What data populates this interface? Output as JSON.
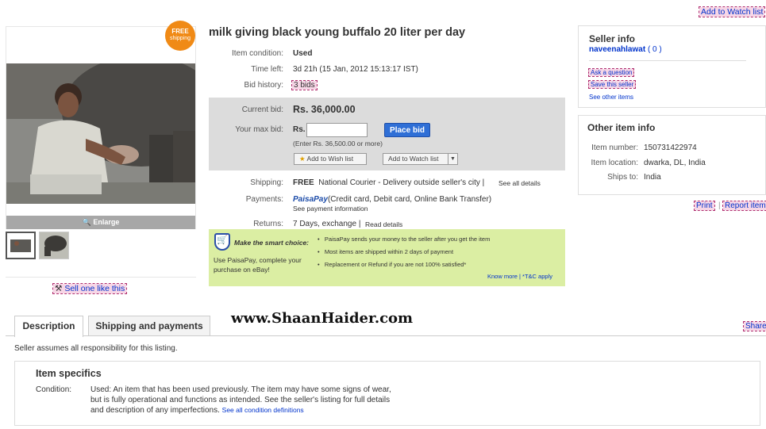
{
  "top_watch": "Add to Watch list",
  "badge": {
    "line1": "FREE",
    "line2": "shipping"
  },
  "enlarge": "Enlarge",
  "sell_one": "Sell one like this",
  "title": "milk giving black young buffalo 20 liter per day",
  "condition": {
    "label": "Item condition:",
    "value": "Used"
  },
  "time_left": {
    "label": "Time left:",
    "value": "3d 21h (15 Jan, 2012 15:13:17 IST)"
  },
  "bid_history": {
    "label": "Bid history:",
    "value": "3 bids"
  },
  "current_bid": {
    "label": "Current bid:",
    "value": "Rs. 36,000.00"
  },
  "max_bid": {
    "label": "Your max bid:",
    "currency": "Rs.",
    "hint": "(Enter Rs. 36,500.00 or more)"
  },
  "place_bid": "Place bid",
  "wish_list": "Add to Wish list",
  "watch_list": "Add to Watch list",
  "shipping": {
    "label": "Shipping:",
    "free": "FREE",
    "value": "National Courier - Delivery outside seller's city",
    "link": "See all details"
  },
  "payments": {
    "label": "Payments:",
    "brand": "PaisaPay",
    "value": "(Credit card, Debit card, Online Bank Transfer)",
    "link": "See payment information"
  },
  "returns": {
    "label": "Returns:",
    "value": "7 Days, exchange",
    "link": "Read details"
  },
  "smart": {
    "title": "Make the smart choice:",
    "desc": "Use PaisaPay, complete your purchase on eBay!",
    "bullets": [
      "PaisaPay sends your money to the seller after you get the item",
      "Most items are shipped within 2 days of payment",
      "Replacement or Refund if you are not 100% satisfied*"
    ],
    "footer": "Know more | *T&C apply"
  },
  "seller": {
    "heading": "Seller info",
    "name": "naveenahlawat",
    "score": "( 0 )",
    "ask": "Ask a question",
    "save": "Save this seller",
    "other": "See other items"
  },
  "other_info": {
    "heading": "Other item info",
    "rows": [
      {
        "label": "Item number:",
        "value": "150731422974"
      },
      {
        "label": "Item location:",
        "value": "dwarka, DL, India"
      },
      {
        "label": "Ships to:",
        "value": "India"
      }
    ]
  },
  "print": "Print",
  "report": "Report item",
  "tabs": [
    "Description",
    "Shipping and payments"
  ],
  "watermark": "www.ShaanHaider.com",
  "share": "Share",
  "assumes": "Seller assumes all responsibility for this listing.",
  "specifics": {
    "heading": "Item specifics",
    "label": "Condition:",
    "text1": "Used: An item that has been used previously. The item may have some signs of wear,",
    "text2": "but is fully operational and functions as intended. See the seller's listing for full details",
    "text3": "and description of any imperfections.",
    "link": "See all condition definitions"
  }
}
